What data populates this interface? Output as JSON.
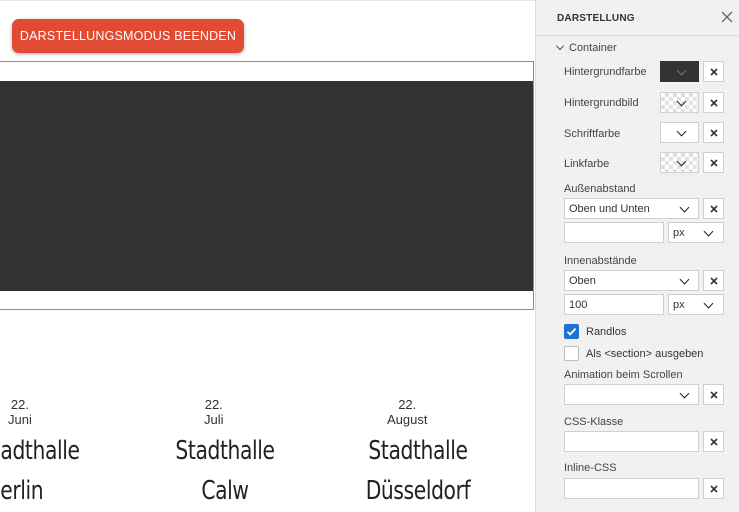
{
  "canvas": {
    "exit_button": "DARSTELLUNGSMODUS BEENDEN",
    "events": [
      {
        "date": "22. Juni",
        "venue_line1": "adthalle",
        "venue_line2": "Berlin"
      },
      {
        "date": "22. Juli",
        "venue_line1": "Stadthalle",
        "venue_line2": "Calw"
      },
      {
        "date": "22. August",
        "venue_line1": "Stadthalle",
        "venue_line2": "Düsseldorf"
      }
    ]
  },
  "panel": {
    "title": "DARSTELLUNG",
    "section": "Container",
    "fields": {
      "bg_color": "Hintergrundfarbe",
      "bg_image": "Hintergrundbild",
      "font_color": "Schriftfarbe",
      "link_color": "Linkfarbe",
      "margin": "Außenabstand",
      "margin_select": "Oben und Unten",
      "margin_value": "",
      "margin_unit": "px",
      "padding": "Innenabstände",
      "padding_select": "Oben",
      "padding_value": "100",
      "padding_unit": "px",
      "borderless": "Randlos",
      "as_section": "Als <section> ausgeben",
      "animation": "Animation beim Scrollen",
      "animation_select": "",
      "css_class": "CSS-Klasse",
      "css_class_value": "",
      "inline_css": "Inline-CSS",
      "inline_css_value": ""
    },
    "state": {
      "borderless_checked": true,
      "as_section_checked": false
    }
  },
  "colors": {
    "accent_button": "#e14a33",
    "dark_block": "#333333",
    "selection_border": "#5b9bd5",
    "checkbox_on": "#1e73d2",
    "panel_bg": "#f1f1f1"
  },
  "icons": [
    "close-icon",
    "chevron-down-icon",
    "remove-x-icon",
    "checkmark-icon"
  ]
}
